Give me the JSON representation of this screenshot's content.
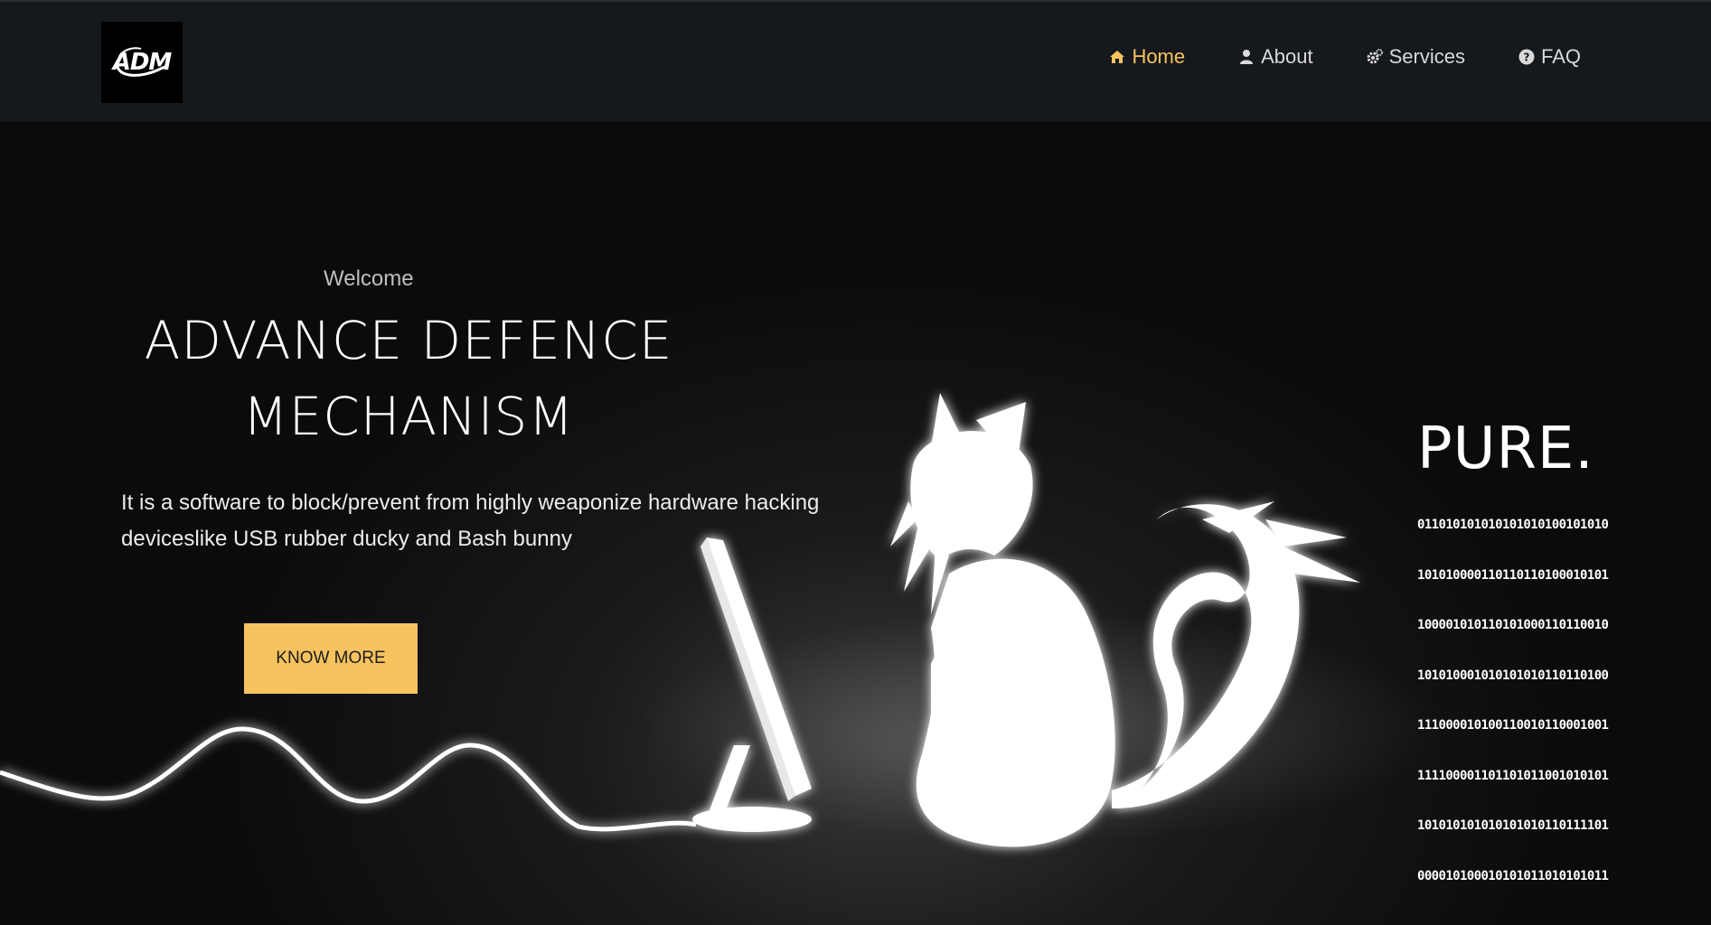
{
  "header": {
    "logo_text": "ADM",
    "nav": [
      {
        "label": "Home",
        "icon": "home-icon",
        "active": true
      },
      {
        "label": "About",
        "icon": "user-icon",
        "active": false
      },
      {
        "label": "Services",
        "icon": "gears-icon",
        "active": false
      },
      {
        "label": "FAQ",
        "icon": "question-circle-icon",
        "active": false
      }
    ]
  },
  "hero": {
    "welcome": "Welcome",
    "title_line1": "ADVANCE DEFENCE",
    "title_line2": "MECHANISM",
    "description": "It is a software to block/prevent from highly weaponize hardware hacking deviceslike USB rubber ducky and Bash bunny",
    "cta_label": "KNOW MORE"
  },
  "art": {
    "pure_text": "PURE.",
    "binary_lines": [
      "011010101010101010100101010",
      "101010000110110110100010101",
      "100001010110101000110110010",
      "101010001010101010110110100",
      "111000010100110010110001001",
      "111100001101101011001010101",
      "101010101010101010110111101",
      "000010100010101011010101011"
    ]
  },
  "colors": {
    "accent": "#f7c35f",
    "navbar_bg": "#15181c",
    "page_bg": "#0b0b0c"
  }
}
